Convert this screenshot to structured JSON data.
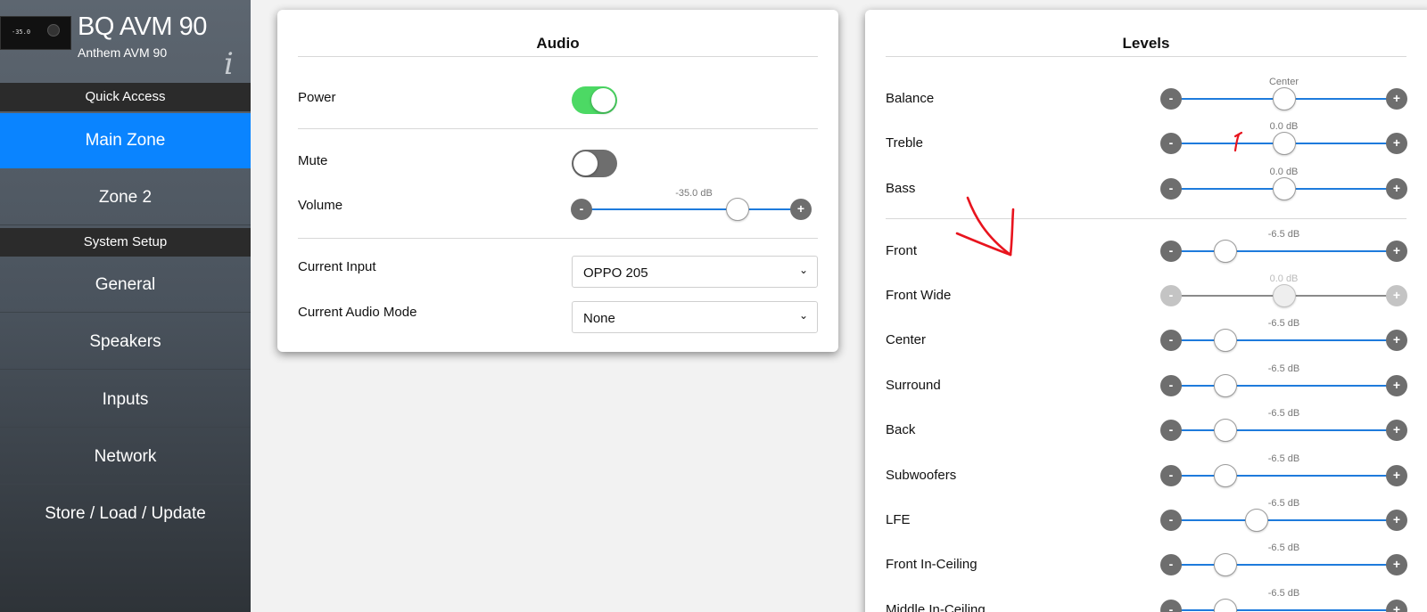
{
  "device": {
    "name": "BQ AVM 90",
    "model": "Anthem AVM 90",
    "display_text": "-35.0",
    "info_glyph": "i"
  },
  "sidebar": {
    "quick_access_label": "Quick Access",
    "system_setup_label": "System Setup",
    "quick_items": [
      {
        "label": "Main Zone",
        "active": true
      },
      {
        "label": "Zone 2",
        "active": false
      }
    ],
    "setup_items": [
      {
        "label": "General"
      },
      {
        "label": "Speakers"
      },
      {
        "label": "Inputs"
      },
      {
        "label": "Network"
      },
      {
        "label": "Store / Load / Update"
      }
    ]
  },
  "audio": {
    "title": "Audio",
    "power": {
      "label": "Power",
      "on": true
    },
    "mute": {
      "label": "Mute",
      "on": false
    },
    "volume": {
      "label": "Volume",
      "value_text": "-35.0 dB",
      "position": 0.71
    },
    "current_input": {
      "label": "Current Input",
      "value": "OPPO 205"
    },
    "current_audio_mode": {
      "label": "Current Audio Mode",
      "value": "None"
    }
  },
  "levels": {
    "title": "Levels",
    "rows": [
      {
        "label": "Balance",
        "value_text": "Center",
        "position": 0.5,
        "disabled": false
      },
      {
        "label": "Treble",
        "value_text": "0.0 dB",
        "position": 0.5,
        "disabled": false
      },
      {
        "label": "Bass",
        "value_text": "0.0 dB",
        "position": 0.5,
        "disabled": false
      },
      {
        "label": "Front",
        "value_text": "-6.5 dB",
        "position": 0.24,
        "disabled": false
      },
      {
        "label": "Front Wide",
        "value_text": "0.0 dB",
        "position": 0.5,
        "disabled": true
      },
      {
        "label": "Center",
        "value_text": "-6.5 dB",
        "position": 0.24,
        "disabled": false
      },
      {
        "label": "Surround",
        "value_text": "-6.5 dB",
        "position": 0.24,
        "disabled": false
      },
      {
        "label": "Back",
        "value_text": "-6.5 dB",
        "position": 0.24,
        "disabled": false
      },
      {
        "label": "Subwoofers",
        "value_text": "-6.5 dB",
        "position": 0.24,
        "disabled": false
      },
      {
        "label": "LFE",
        "value_text": "-6.5 dB",
        "position": 0.38,
        "disabled": false
      },
      {
        "label": "Front In-Ceiling",
        "value_text": "-6.5 dB",
        "position": 0.24,
        "disabled": false
      },
      {
        "label": "Middle In-Ceiling",
        "value_text": "-6.5 dB",
        "position": 0.24,
        "disabled": false
      }
    ]
  },
  "controls": {
    "minus_glyph": "-",
    "plus_glyph": "+",
    "chevron_glyph": "⌄"
  },
  "colors": {
    "accent": "#0a84ff",
    "toggle_on": "#4cd964",
    "toggle_off": "#6e6e6e",
    "slider_track": "#1e7bdc",
    "annotation": "#e8141e"
  }
}
